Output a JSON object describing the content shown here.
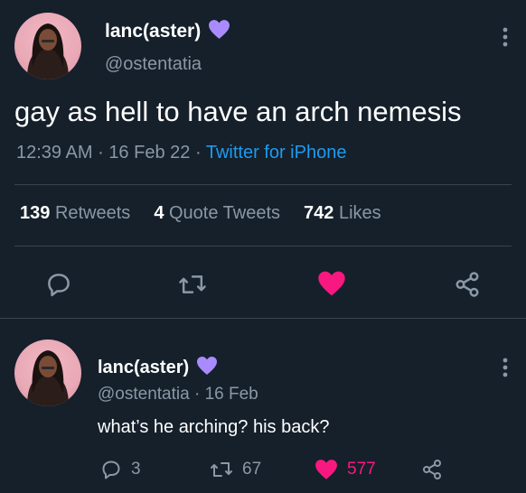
{
  "main_tweet": {
    "display_name": "lanc(aster)",
    "handle": "@ostentatia",
    "text": "gay as hell to have an arch nemesis",
    "time": "12:39 AM",
    "date": "16 Feb 22",
    "source": "Twitter for iPhone",
    "separator": "·",
    "stats": {
      "retweets_count": "139",
      "retweets_label": "Retweets",
      "quotes_count": "4",
      "quotes_label": "Quote Tweets",
      "likes_count": "742",
      "likes_label": "Likes"
    },
    "liked": true
  },
  "reply": {
    "display_name": "lanc(aster)",
    "handle": "@ostentatia",
    "separator": "·",
    "date": "16 Feb",
    "text": "what’s he arching? his back?",
    "reply_count": "3",
    "retweet_count": "67",
    "like_count": "577",
    "liked": true
  },
  "colors": {
    "background": "#15202b",
    "text": "#ffffff",
    "secondary": "#8b98a5",
    "accent_blue": "#1d9bf0",
    "like_pink": "#f91880",
    "verified_heart": "#a98bff",
    "divider": "#38444d"
  },
  "icons": {
    "reply": "reply-icon",
    "retweet": "retweet-icon",
    "like": "heart-icon",
    "share": "share-icon",
    "more": "more-icon",
    "badge": "purple-heart-icon"
  }
}
